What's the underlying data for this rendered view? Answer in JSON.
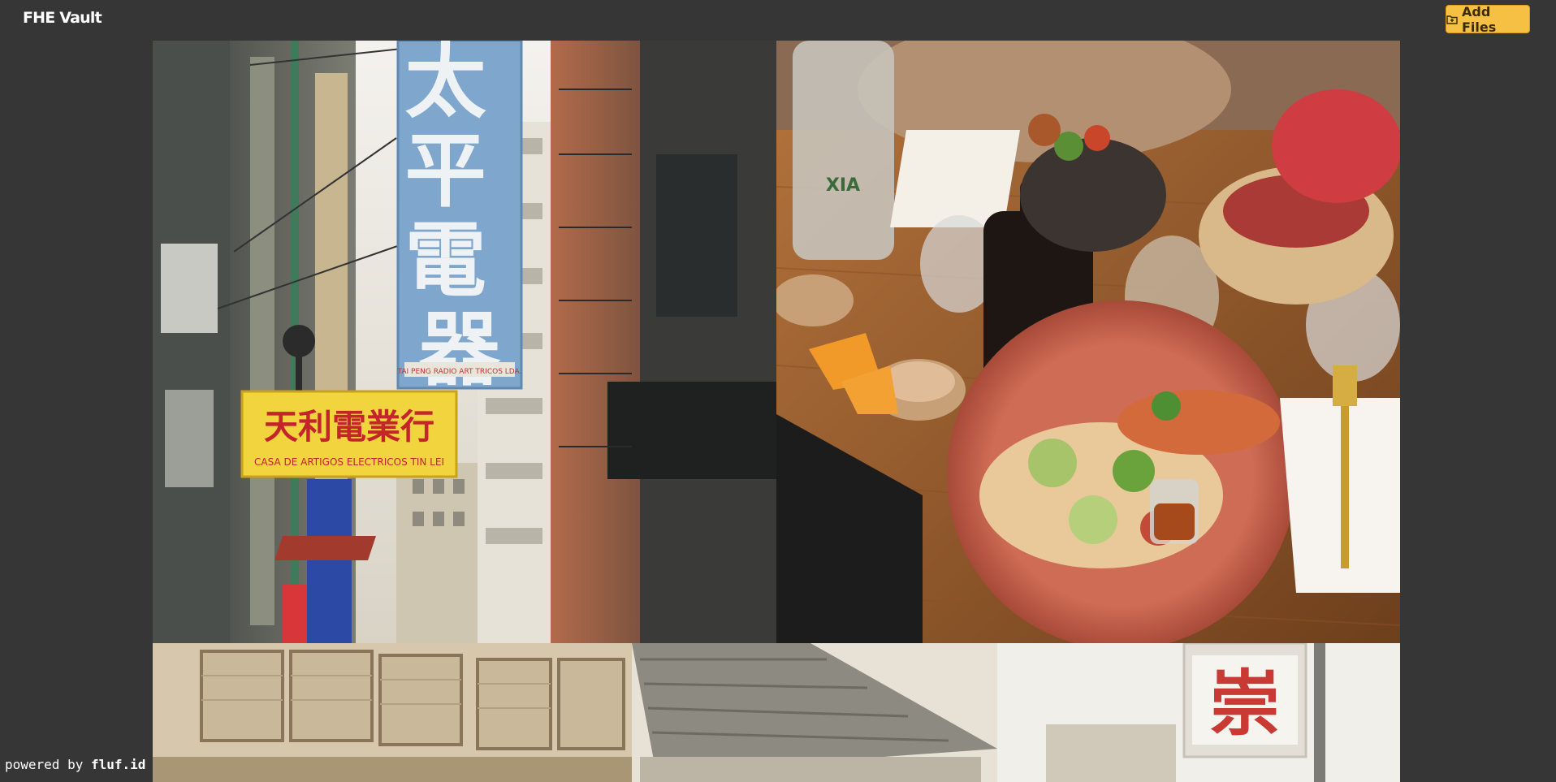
{
  "app": {
    "title": "FHE Vault"
  },
  "toolbar": {
    "add_files_label": "Add Files",
    "add_files_icon": "folder-plus-icon"
  },
  "gallery": {
    "photos": [
      {
        "name": "street-signs-photo",
        "sign_main": "太平電器",
        "sign_shop": "天利電業行",
        "sign_shop_sub": "CASA DE ARTIGOS ELECTRICOS TIN LEI",
        "sign_small": "TAI PENG RADIO ART TRICOS LDA."
      },
      {
        "name": "food-table-photo",
        "bottle_label": "XIA"
      },
      {
        "name": "old-shop-photo",
        "sign_char": "崇"
      }
    ]
  },
  "footer": {
    "powered_prefix": "powered by",
    "powered_brand": "fluf.id"
  }
}
